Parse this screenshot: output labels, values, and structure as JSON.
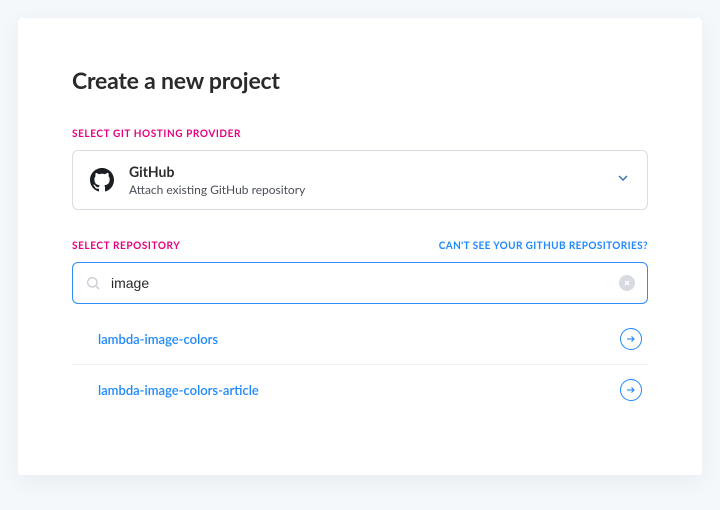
{
  "page": {
    "title": "Create a new project"
  },
  "provider_section": {
    "label": "SELECT GIT HOSTING PROVIDER",
    "selected": {
      "name": "GitHub",
      "subtitle": "Attach existing GitHub repository",
      "icon": "github-icon"
    }
  },
  "repo_section": {
    "label": "SELECT REPOSITORY",
    "help_link": "CAN'T SEE YOUR GITHUB REPOSITORIES?",
    "search": {
      "value": "image",
      "placeholder": ""
    },
    "results": [
      {
        "name": "lambda-image-colors"
      },
      {
        "name": "lambda-image-colors-article"
      }
    ]
  },
  "colors": {
    "accent_magenta": "#e6007e",
    "accent_blue": "#1e88ff"
  }
}
